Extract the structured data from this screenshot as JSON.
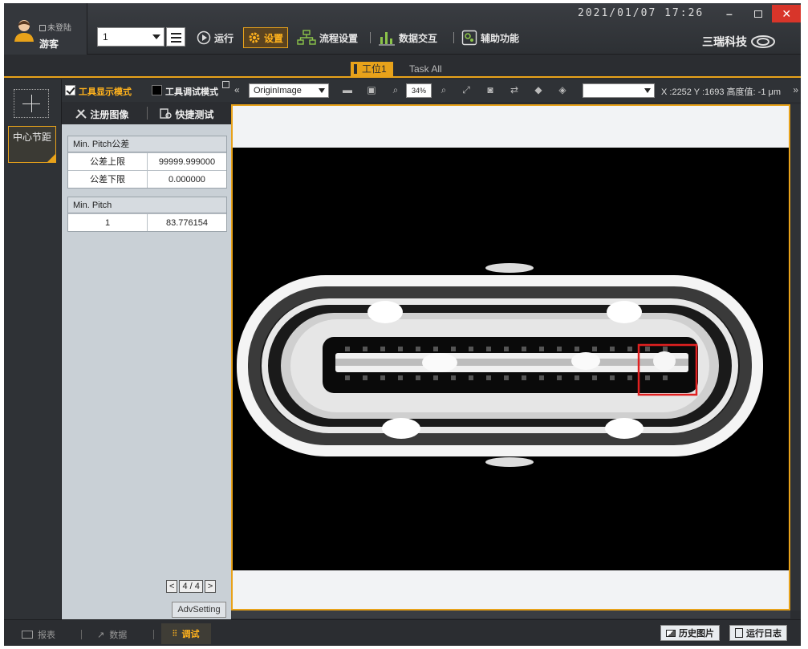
{
  "user": {
    "login_label": "未登陆",
    "name": "游客"
  },
  "toolbar": {
    "station_select": "1",
    "run_label": "运行",
    "settings_label": "设置",
    "flow_label": "流程设置",
    "data_label": "数据交互",
    "aux_label": "辅助功能"
  },
  "datetime": "2021/01/07 17:26",
  "brand": "三瑞科技",
  "tabs": {
    "station1": "工位1",
    "task_all": "Task All"
  },
  "left_tools": {
    "center_pitch": "中心节距"
  },
  "panel": {
    "mode_display": "工具显示模式",
    "mode_debug": "工具调试模式",
    "register_image": "注册图像",
    "quick_test": "快捷测试",
    "tol_table": {
      "title": "Min. Pitch公差",
      "rows": [
        {
          "key": "公差上限",
          "value": "99999.999000"
        },
        {
          "key": "公差下限",
          "value": "0.000000"
        }
      ]
    },
    "pitch_table": {
      "title": "Min. Pitch",
      "rows": [
        {
          "key": "1",
          "value": "83.776154"
        }
      ]
    },
    "pager": {
      "prev": "<",
      "page": "4 / 4",
      "next": ">"
    },
    "adv_setting": "AdvSetting"
  },
  "image_toolbar": {
    "source": "OriginImage",
    "zoom": "34%",
    "coord": "X :2252 Y :1693 高度值: -1 μm"
  },
  "bottom": {
    "report": "报表",
    "data": "数据",
    "debug": "调试",
    "history": "历史图片",
    "log": "运行日志"
  },
  "colors": {
    "accent": "#e8a21a",
    "roi": "#e02020",
    "close": "#d8352a"
  }
}
